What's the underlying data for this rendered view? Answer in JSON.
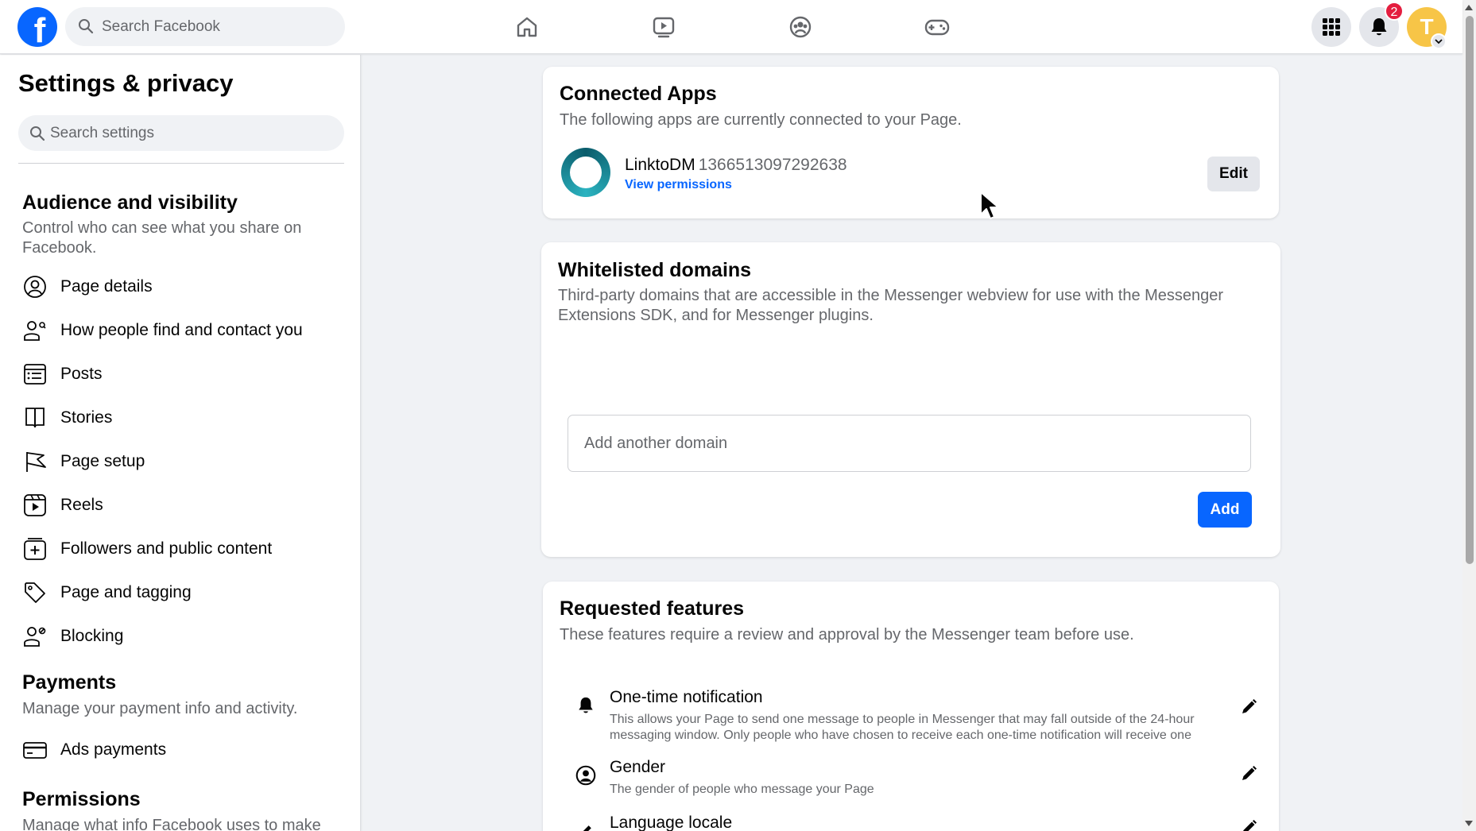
{
  "topbar": {
    "logo_letter": "f",
    "search_placeholder": "Search Facebook",
    "notification_count": "2",
    "avatar_letter": "T",
    "nav_icons": [
      "home-icon",
      "video-icon",
      "groups-icon",
      "gaming-icon"
    ],
    "colors": {
      "brand": "#0866ff",
      "badge": "#e41e3f",
      "avatar": "#f7c547"
    }
  },
  "sidebar": {
    "title": "Settings & privacy",
    "search_placeholder": "Search settings",
    "sections": [
      {
        "title": "Audience and visibility",
        "description": "Control who can see what you share on Facebook.",
        "items": [
          {
            "label": "Page details",
            "icon": "person-circle-icon"
          },
          {
            "label": "How people find and contact you",
            "icon": "person-search-icon"
          },
          {
            "label": "Posts",
            "icon": "posts-icon"
          },
          {
            "label": "Stories",
            "icon": "book-icon"
          },
          {
            "label": "Page setup",
            "icon": "flag-icon"
          },
          {
            "label": "Reels",
            "icon": "reels-icon"
          },
          {
            "label": "Followers and public content",
            "icon": "plus-square-icon"
          },
          {
            "label": "Page and tagging",
            "icon": "tag-icon"
          },
          {
            "label": "Blocking",
            "icon": "person-block-icon"
          }
        ]
      },
      {
        "title": "Payments",
        "description": "Manage your payment info and activity.",
        "items": [
          {
            "label": "Ads payments",
            "icon": "credit-card-icon"
          }
        ]
      },
      {
        "title": "Permissions",
        "description": "Manage what info Facebook uses to make"
      }
    ]
  },
  "connected_apps": {
    "title": "Connected Apps",
    "description": "The following apps are currently connected to your Page.",
    "app": {
      "name": "LinktoDM",
      "id": "1366513097292638",
      "link_label": "View permissions",
      "edit_label": "Edit"
    }
  },
  "whitelisted": {
    "title": "Whitelisted domains",
    "description": "Third-party domains that are accessible in the Messenger webview for use with the Messenger Extensions SDK, and for Messenger plugins.",
    "input_placeholder": "Add another domain",
    "input_value": "",
    "add_label": "Add"
  },
  "requested": {
    "title": "Requested features",
    "description": "These features require a review and approval by the Messenger team before use.",
    "features": [
      {
        "name": "One-time notification",
        "description": "This allows your Page to send one message to people in Messenger that may fall outside of the 24-hour messaging window. Only people who have chosen to receive each one-time notification will receive one",
        "icon": "bell-icon"
      },
      {
        "name": "Gender",
        "description": "The gender of people who message your Page",
        "icon": "person-circle-icon"
      },
      {
        "name": "Language locale",
        "description": "",
        "icon": "pencil-icon"
      }
    ]
  }
}
